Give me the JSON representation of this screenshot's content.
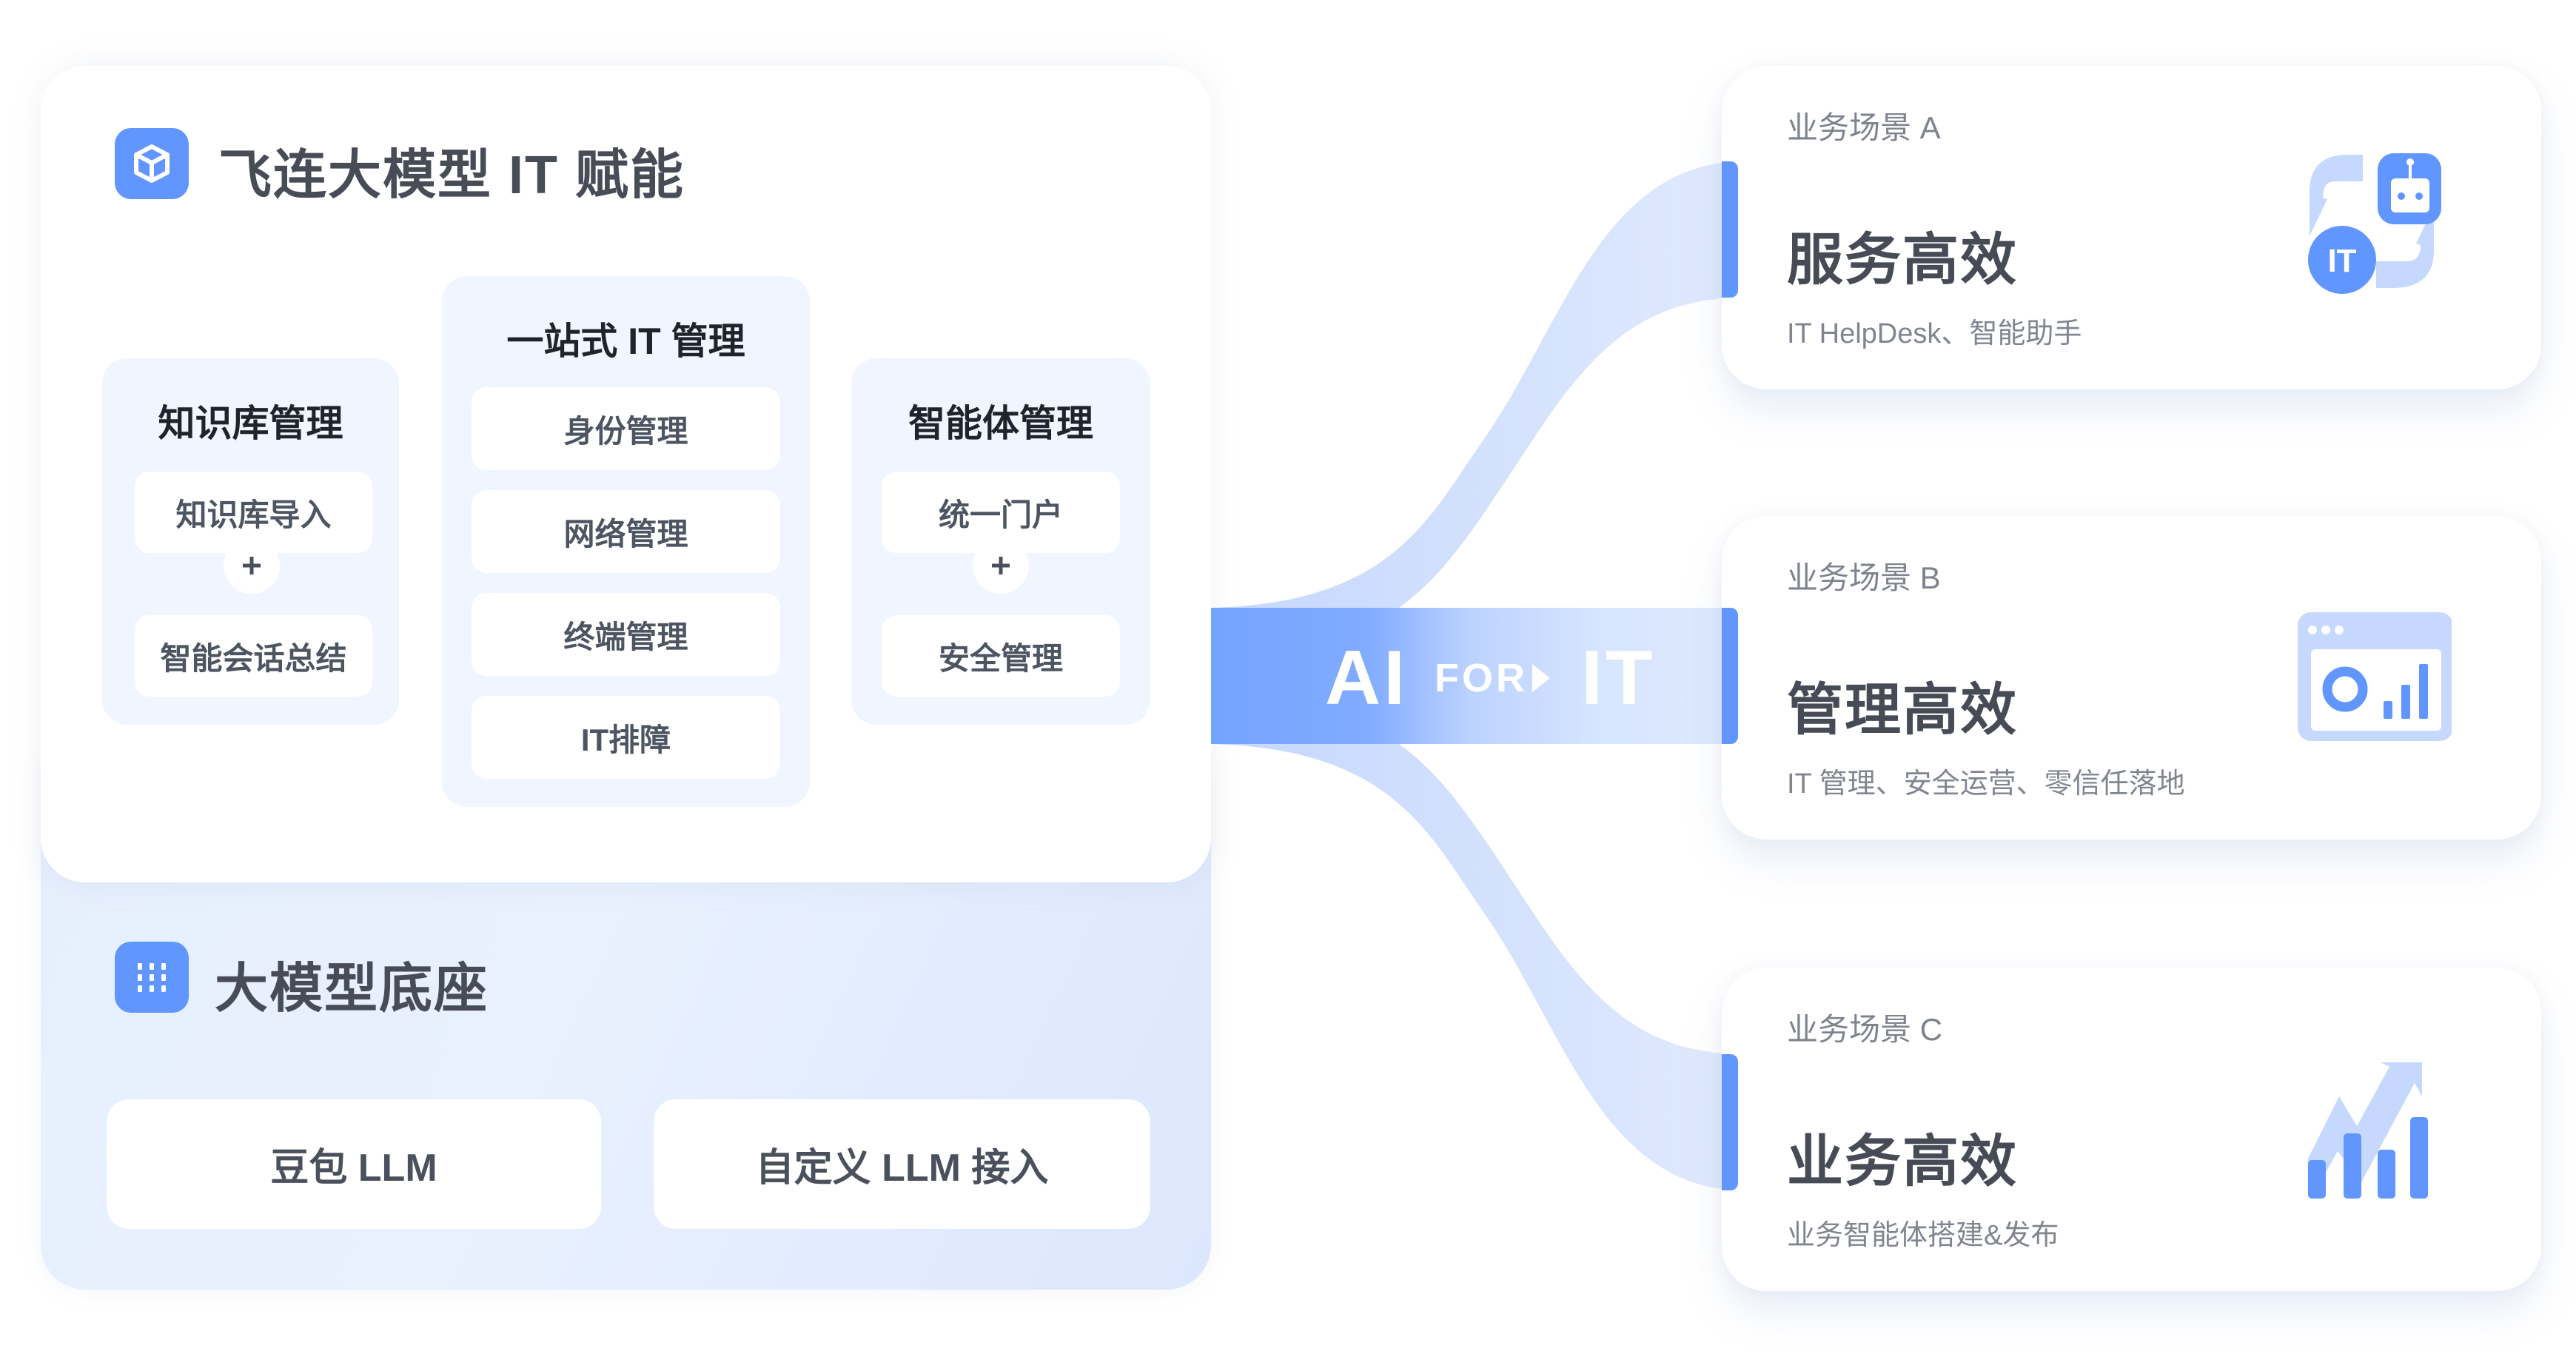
{
  "platform": {
    "header": {
      "icon": "cube-icon",
      "title": "飞连大模型 IT 赋能"
    },
    "columns": [
      {
        "title": "知识库管理",
        "items": [
          "知识库导入",
          "智能会话总结"
        ],
        "joiner": "plus-icon"
      },
      {
        "title": "一站式 IT 管理",
        "items": [
          "身份管理",
          "网络管理",
          "终端管理",
          "IT排障"
        ]
      },
      {
        "title": "智能体管理",
        "items": [
          "统一门户",
          "安全管理"
        ],
        "joiner": "plus-icon"
      }
    ],
    "base": {
      "icon": "grid-dots-icon",
      "title": "大模型底座",
      "models": [
        "豆包 LLM",
        "自定义 LLM 接入"
      ]
    }
  },
  "connector": {
    "ai": "AI",
    "for": "FOR",
    "it": "IT",
    "arrow_icon": "play-triangle-icon"
  },
  "scenarios": [
    {
      "label": "业务场景 A",
      "title": "服务高效",
      "description": "IT HelpDesk、智能助手",
      "icon": "it-robot-exchange-icon",
      "icon_badge": "IT"
    },
    {
      "label": "业务场景 B",
      "title": "管理高效",
      "description": "IT 管理、安全运营、零信任落地",
      "icon": "dashboard-window-icon"
    },
    {
      "label": "业务场景 C",
      "title": "业务高效",
      "description": "业务智能体搭建&发布",
      "icon": "growth-chart-icon"
    }
  ],
  "colors": {
    "accent": "#6196ff",
    "accent_light": "#c6d8fd",
    "column_bg": "#f0f5ff",
    "title_text": "#474c57",
    "muted_text": "#7e838d"
  }
}
